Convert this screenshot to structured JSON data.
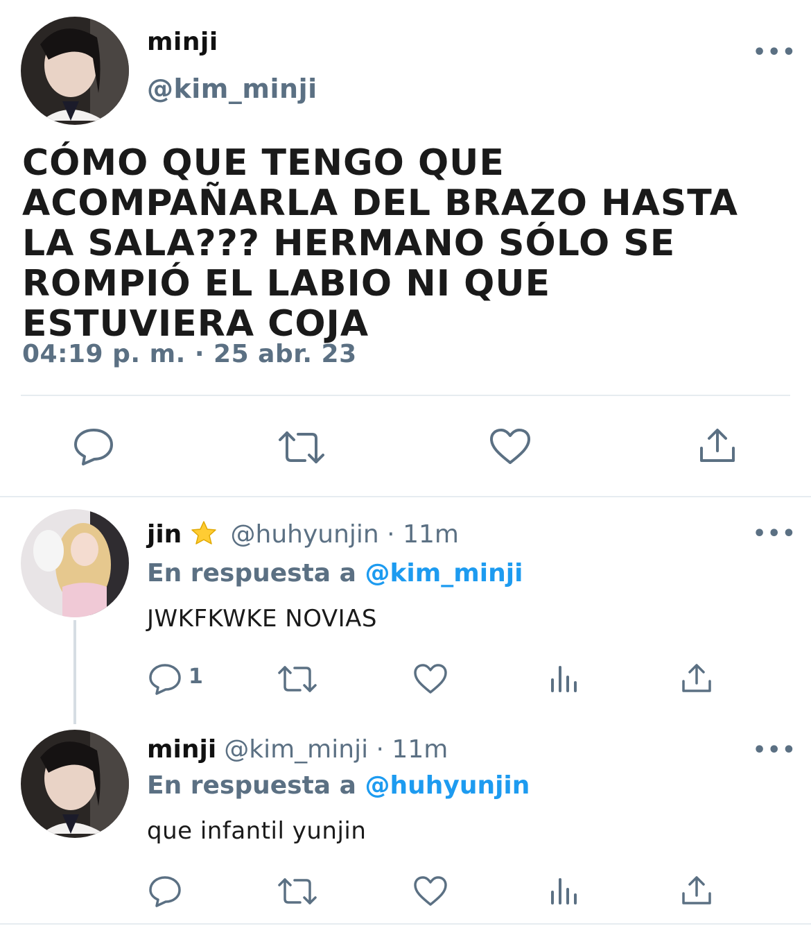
{
  "main_tweet": {
    "display_name": "minji",
    "handle": "@kim_minji",
    "text": "CÓMO QUE TENGO QUE ACOMPAÑARLA DEL BRAZO HASTA LA SALA??? HERMANO SÓLO SE ROMPIÓ EL LABIO NI QUE ESTUVIERA COJA",
    "timestamp": "04:19 p. m. · 25 abr. 23",
    "more_label": "•••"
  },
  "replies": [
    {
      "display_name": "jin",
      "badge_icon": "star-icon",
      "handle": "@huhyunjin",
      "separator": " · ",
      "time": "11m",
      "reply_prefix": "En respuesta a ",
      "reply_to": "@kim_minji",
      "text": "JWKFKWKE NOVIAS",
      "reply_count": "1",
      "more_label": "•••"
    },
    {
      "display_name": "minji",
      "handle": "@kim_minji",
      "separator": " · ",
      "time": "11m",
      "reply_prefix": "En respuesta a ",
      "reply_to": "@huhyunjin",
      "text": "que infantil yunjin",
      "more_label": "•••"
    }
  ],
  "colors": {
    "text": "#1a1a1a",
    "secondary": "#5b7083",
    "link": "#1d9bf0",
    "divider": "#e6ecf0"
  }
}
